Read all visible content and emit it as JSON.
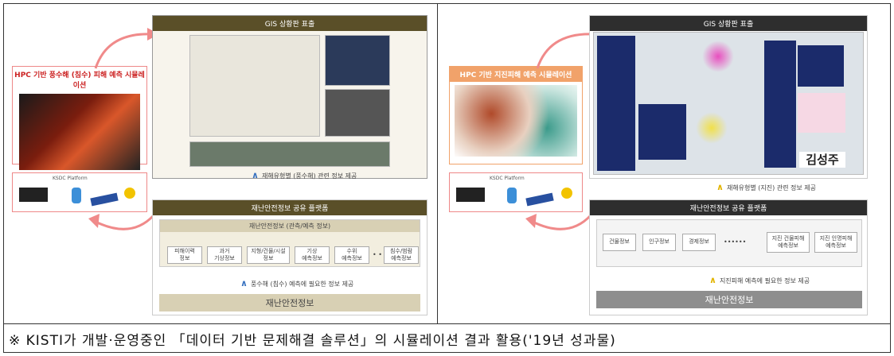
{
  "left": {
    "hpc_title": "HPC 기반 풍수해 (침수) 피해 예측 시뮬레이션",
    "gis_title": "GIS 상황판 표출",
    "gis_note": "재해유형별 (풍수해) 관련 정보 제공",
    "platform_title": "재난안전정보 공유 플랫폼",
    "platform_sub": "재난안전정보 (관측/예측 정보)",
    "items": [
      "피해이력\n정보",
      "과거\n기상정보",
      "지형/건물/시설\n정보",
      "기상\n예측정보",
      "수위\n예측정보",
      "침수/범람\n예측정보"
    ],
    "ellipsis": "• • •",
    "needed_note": "풍수해 (침수) 예측에 필요한 정보 제공",
    "bottom": "재난안전정보",
    "ksdc": "KSDC Platform"
  },
  "right": {
    "hpc_title": "HPC 기반 지진피해 예측 시뮬레이션",
    "gis_title": "GIS 상황판 표출",
    "gis_note": "재해유형별 (지진) 관련 정보 제공",
    "platform_title": "재난안전정보 공유 플랫폼",
    "items": [
      "건물정보",
      "인구정보",
      "경제정보"
    ],
    "dots": "••••••",
    "items2": [
      "지진 건물피해\n예측정보",
      "지진 인명피해\n예측정보"
    ],
    "needed_note": "지진피해 예측에 필요한 정보 제공",
    "bottom": "재난안전정보",
    "sign": "김성주",
    "ksdc": "KSDC Platform"
  },
  "caption": "※ KISTI가 개발·운영중인 「데이터 기반 문제해결 솔루션」의 시뮬레이션 결과 활용('19년 성과물)",
  "colors": {
    "olive": "#5a4f28",
    "accent_blue": "#3a73c0",
    "accent_yellow": "#e2b400",
    "pink": "#f08a8a"
  }
}
